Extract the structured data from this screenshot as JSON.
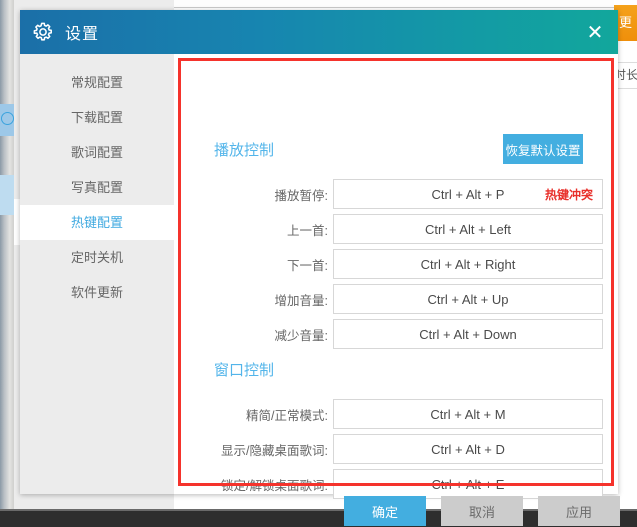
{
  "background": {
    "right_tab_label": "更",
    "right_col_text": "时长"
  },
  "dialog": {
    "title": "设置",
    "gear_icon": "gear-icon",
    "close_icon": "close-icon",
    "close_glyph": "✕"
  },
  "sidebar": {
    "items": [
      {
        "label": "常规配置",
        "active": false
      },
      {
        "label": "下载配置",
        "active": false
      },
      {
        "label": "歌词配置",
        "active": false
      },
      {
        "label": "写真配置",
        "active": false
      },
      {
        "label": "热键配置",
        "active": true
      },
      {
        "label": "定时关机",
        "active": false
      },
      {
        "label": "软件更新",
        "active": false
      }
    ]
  },
  "content": {
    "reset_button": "恢复默认设置",
    "sections": [
      {
        "title": "播放控制",
        "rows": [
          {
            "label": "播放暂停:",
            "value": "Ctrl + Alt + P",
            "conflict": "热键冲突"
          },
          {
            "label": "上一首:",
            "value": "Ctrl + Alt + Left",
            "conflict": ""
          },
          {
            "label": "下一首:",
            "value": "Ctrl + Alt + Right",
            "conflict": ""
          },
          {
            "label": "增加音量:",
            "value": "Ctrl + Alt + Up",
            "conflict": ""
          },
          {
            "label": "减少音量:",
            "value": "Ctrl + Alt + Down",
            "conflict": ""
          }
        ]
      },
      {
        "title": "窗口控制",
        "rows": [
          {
            "label": "精简/正常模式:",
            "value": "Ctrl + Alt + M",
            "conflict": ""
          },
          {
            "label": "显示/隐藏桌面歌词:",
            "value": "Ctrl + Alt + D",
            "conflict": ""
          },
          {
            "label": "锁定/解锁桌面歌词:",
            "value": "Ctrl + Alt + E",
            "conflict": ""
          }
        ]
      }
    ]
  },
  "footer": {
    "ok": "确定",
    "cancel": "取消",
    "apply": "应用"
  },
  "colors": {
    "accent": "#43aee0",
    "title_gradient_start": "#1b6fa8",
    "title_gradient_end": "#12a79c",
    "section_title": "#53b5ea",
    "conflict_red": "#e8302b",
    "annotation_red": "#f5332c",
    "sidebar_bg": "#ececec"
  }
}
